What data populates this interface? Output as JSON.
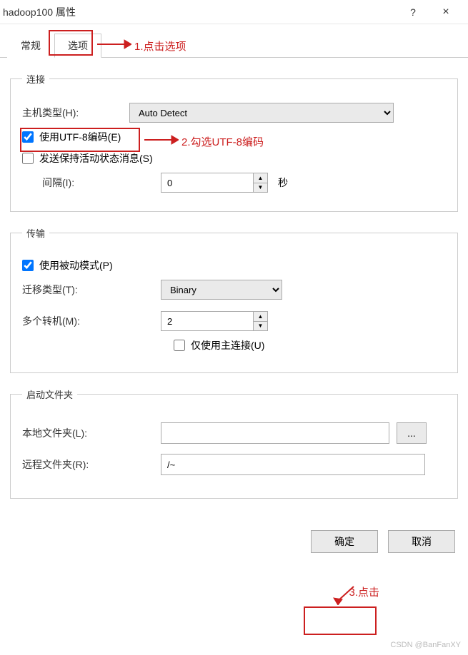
{
  "window": {
    "title": "hadoop100 属性",
    "help_symbol": "?",
    "close_symbol": "×"
  },
  "tabs": {
    "general": "常规",
    "options": "选项"
  },
  "annotations": {
    "a1": "1.点击选项",
    "a2": "2.勾选UTF-8编码",
    "a3": "3.点击"
  },
  "conn": {
    "legend": "连接",
    "host_type_label": "主机类型(H):",
    "host_type_value": "Auto Detect",
    "utf8_label": "使用UTF-8编码(E)",
    "keepalive_label": "发送保持活动状态消息(S)",
    "interval_label": "间隔(I):",
    "interval_value": "0",
    "interval_unit": "秒"
  },
  "trans": {
    "legend": "传输",
    "passive_label": "使用被动模式(P)",
    "transfer_type_label": "迁移类型(T):",
    "transfer_type_value": "Binary",
    "multi_label": "多个转机(M):",
    "multi_value": "2",
    "primary_only_label": "仅使用主连接(U)"
  },
  "startup": {
    "legend": "启动文件夹",
    "local_label": "本地文件夹(L):",
    "local_value": "",
    "remote_label": "远程文件夹(R):",
    "remote_value": "/~",
    "browse_label": "..."
  },
  "buttons": {
    "ok": "确定",
    "cancel": "取消"
  },
  "watermark": "CSDN @BanFanXY"
}
